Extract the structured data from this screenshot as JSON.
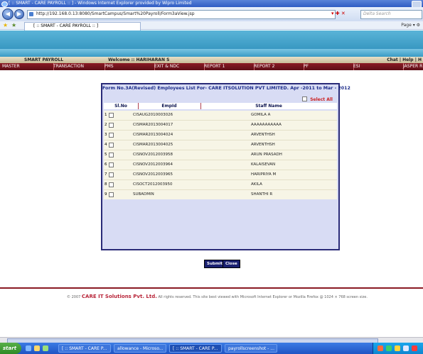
{
  "browser": {
    "window_title": "[ :: SMART - CARE PAYROLL :: ] - Windows Internet Explorer provided by Wipro Limited",
    "url": "http://192.168.0.13:8080/SmartCampus/Smart%20Payroll/Form3aView.jsp",
    "search_placeholder": "Delta Search",
    "tab_title": "[ :: SMART - CARE PAYROLL :: ]",
    "tab_tools": "Page ▾ ⚙"
  },
  "header": {
    "app_name": "SMART PAYROLL",
    "welcome": "Welcome :: HARIHARAN S",
    "links": "Chat | Help | H"
  },
  "menu": [
    "MASTER",
    "TRANSACTION",
    "PMS",
    "EXIT & NDC",
    "REPORT 1",
    "REPORT 2",
    "PF",
    "ESI",
    "JASPER R"
  ],
  "form": {
    "title": "Form No.3A(Revised) Employees List For-  CARE ITSOLUTION PVT LIMITED. Apr -2011 to Mar - 2012",
    "select_all": "Select All",
    "columns": [
      "Sl.No",
      "EmpId",
      "Staff Name"
    ],
    "rows": [
      {
        "sl": "1",
        "emp": "CISAUG2010003026",
        "name": "GOMILA A"
      },
      {
        "sl": "2",
        "emp": "CISMAR2013004017",
        "name": "AAAAAAAAAAA"
      },
      {
        "sl": "3",
        "emp": "CISMAR2013004024",
        "name": "ARVENTHSH"
      },
      {
        "sl": "4",
        "emp": "CISMAR2013004025",
        "name": "ARVENTHSH"
      },
      {
        "sl": "5",
        "emp": "CISNOV2012003958",
        "name": "ARUN PRASADH"
      },
      {
        "sl": "6",
        "emp": "CISNOV2012003964",
        "name": "KALAISEVAN"
      },
      {
        "sl": "7",
        "emp": "CISNOV2012003965",
        "name": "HARIPRIYA M"
      },
      {
        "sl": "8",
        "emp": "CISOCT2012003950",
        "name": "AKILA"
      },
      {
        "sl": "9",
        "emp": "SUBADMIN",
        "name": "SHANTHI R"
      }
    ],
    "submit": "Submit",
    "close": "Close"
  },
  "footer": {
    "copyright": "© 2007",
    "company": "CARE IT Solutions Pvt. Ltd.",
    "notice": "All rights reserved.  This site best viewed with Microsoft Internet Explorer or Mozilla Firefox @ 1024 × 768 screen size."
  },
  "taskbar": {
    "start": "start",
    "tasks": [
      "[ :: SMART - CARE P...",
      "allowance - Microso...",
      "[ :: SMART - CARE P...",
      "payrollscreenshot - ..."
    ]
  },
  "colors": {
    "menu_bg": "#7a1620",
    "panel_bg": "#d8dcf4",
    "panel_border": "#2a2b78",
    "row_bg": "#f7f5e6",
    "title_text": "#1d2c8a",
    "brand": "#b8263a"
  }
}
